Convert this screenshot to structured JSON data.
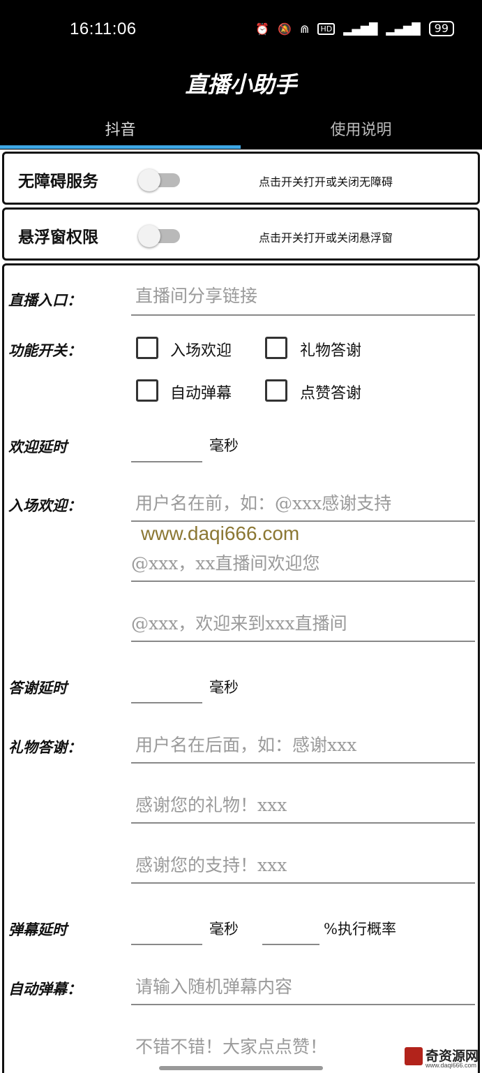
{
  "status": {
    "time": "16:11:06",
    "icons": [
      "alarm-icon",
      "mute-icon",
      "wifi-icon",
      "hd-icon",
      "signal-4g-icon",
      "signal-4g-icon"
    ],
    "battery": "99"
  },
  "app": {
    "title": "直播小助手",
    "tabs": [
      {
        "label": "抖音",
        "active": true
      },
      {
        "label": "使用说明",
        "active": false
      }
    ],
    "accent_color": "#3ea7e5"
  },
  "accessibility": {
    "label": "无障碍服务",
    "enabled": false,
    "hint": "点击开关打开或关闭无障碍"
  },
  "overlay": {
    "label": "悬浮窗权限",
    "enabled": false,
    "hint": "点击开关打开或关闭悬浮窗"
  },
  "form": {
    "entry_label": "直播入口：",
    "entry_placeholder": "直播间分享链接",
    "switches_label": "功能开关：",
    "checkboxes": [
      {
        "label": "入场欢迎",
        "checked": false
      },
      {
        "label": "礼物答谢",
        "checked": false
      },
      {
        "label": "自动弹幕",
        "checked": false
      },
      {
        "label": "点赞答谢",
        "checked": false
      }
    ],
    "welcome_delay_label": "欢迎延时",
    "ms_unit": "毫秒",
    "welcome_label": "入场欢迎：",
    "welcome_lines": [
      "用户名在前，如：@xxx感谢支持",
      "@xxx，xx直播间欢迎您",
      "@xxx，欢迎来到xxx直播间"
    ],
    "thanks_delay_label": "答谢延时",
    "gift_label": "礼物答谢：",
    "gift_lines": [
      "用户名在后面，如：感谢xxx",
      "感谢您的礼物！xxx",
      "感谢您的支持！xxx"
    ],
    "danmaku_delay_label": "弹幕延时",
    "probability_unit": "%执行概率",
    "auto_danmaku_label": "自动弹幕：",
    "danmaku_lines": [
      "请输入随机弹幕内容",
      "不错不错！大家点点赞！"
    ]
  },
  "watermark": "www.daqi666.com",
  "brand": {
    "name": "奇资源网",
    "url": "www.daqi666.com"
  }
}
